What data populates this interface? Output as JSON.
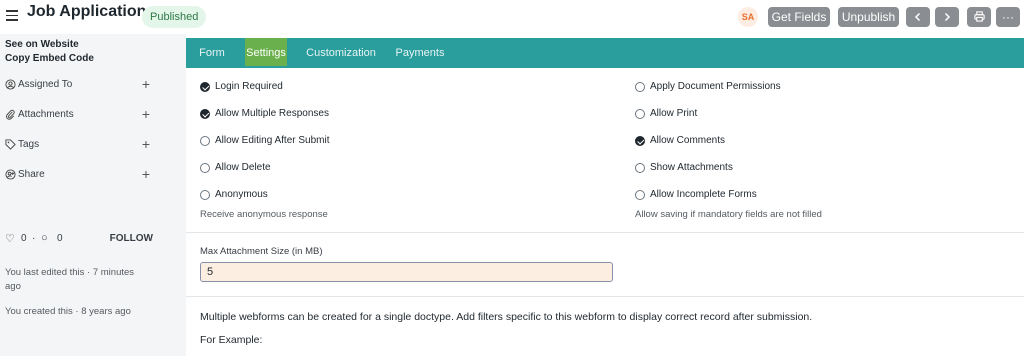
{
  "header": {
    "title": "Job Application",
    "status_badge": "Published",
    "avatar_initials": "SA",
    "get_fields_label": "Get Fields",
    "unpublish_label": "Unpublish",
    "prev_icon": "chevron-left-icon",
    "next_icon": "chevron-right-icon",
    "print_icon": "printer-icon",
    "more_icon": "more-icon",
    "more_glyph": "···"
  },
  "sidebar": {
    "see_on_website": "See on Website",
    "copy_embed": "Copy Embed Code",
    "items": [
      {
        "label": "Assigned To",
        "icon": "user-circle-icon"
      },
      {
        "label": "Attachments",
        "icon": "paperclip-icon"
      },
      {
        "label": "Tags",
        "icon": "tag-icon"
      },
      {
        "label": "Share",
        "icon": "share-icon"
      }
    ],
    "likes": "0",
    "comments": "0",
    "follow": "FOLLOW",
    "last_edited": "You last edited this · 7 minutes ago",
    "created": "You created this · 8 years ago"
  },
  "tabs": [
    {
      "label": "Form"
    },
    {
      "label": "Settings"
    },
    {
      "label": "Customization"
    },
    {
      "label": "Payments"
    }
  ],
  "settings": {
    "left": [
      {
        "label": "Login Required",
        "checked": true
      },
      {
        "label": "Allow Multiple Responses",
        "checked": true
      },
      {
        "label": "Allow Editing After Submit",
        "checked": false
      },
      {
        "label": "Allow Delete",
        "checked": false
      },
      {
        "label": "Anonymous",
        "checked": false
      }
    ],
    "left_desc": "Receive anonymous response",
    "right": [
      {
        "label": "Apply Document Permissions",
        "checked": false
      },
      {
        "label": "Allow Print",
        "checked": false
      },
      {
        "label": "Allow Comments",
        "checked": true
      },
      {
        "label": "Show Attachments",
        "checked": false
      },
      {
        "label": "Allow Incomplete Forms",
        "checked": false
      }
    ],
    "right_desc": "Allow saving if mandatory fields are not filled",
    "max_attachment_label": "Max Attachment Size (in MB)",
    "max_attachment_value": "5",
    "help_text": "Multiple webforms can be created for a single doctype. Add filters specific to this webform to display correct record after submission.",
    "for_example": "For Example:"
  },
  "colors": {
    "tab_bar": "#2a9d9d",
    "active_tab": "#6ab04c",
    "badge_bg": "#e4f5e9",
    "input_bg": "#fdeee2"
  }
}
